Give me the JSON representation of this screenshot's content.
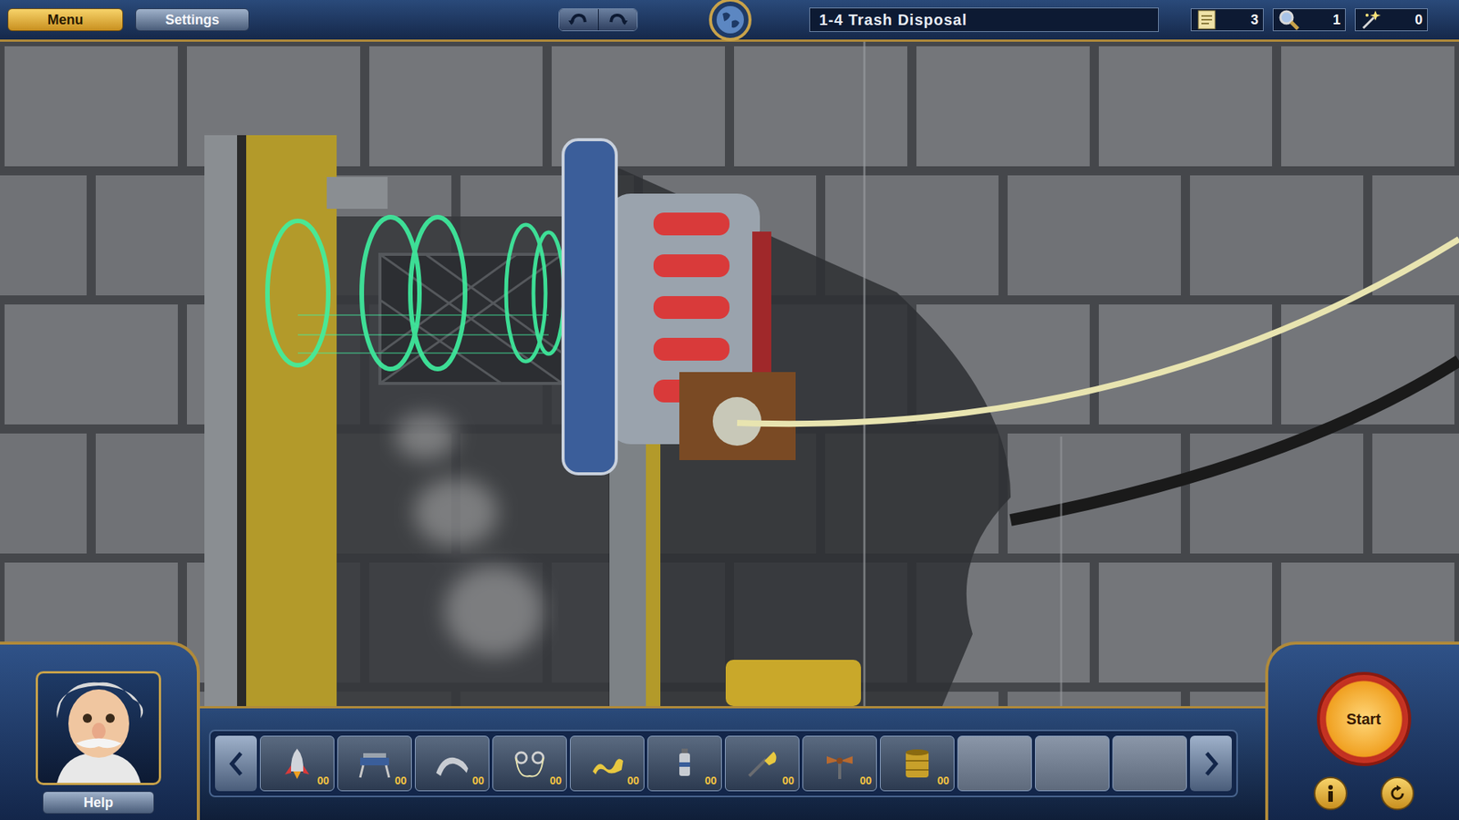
{
  "top_bar": {
    "menu_button": "Menu",
    "settings_button": "Settings",
    "level_title": "1-4 Trash Disposal",
    "counters": [
      {
        "value": "3"
      },
      {
        "value": "1"
      },
      {
        "value": "0"
      }
    ]
  },
  "help_panel": {
    "help_button": "Help"
  },
  "toolbar": {
    "slots": [
      {
        "kind": "item",
        "count": "00"
      },
      {
        "kind": "item",
        "count": "00"
      },
      {
        "kind": "item",
        "count": "00"
      },
      {
        "kind": "item",
        "count": "00"
      },
      {
        "kind": "item",
        "count": "00"
      },
      {
        "kind": "item",
        "count": "00"
      },
      {
        "kind": "item",
        "count": "00"
      },
      {
        "kind": "item",
        "count": "00"
      },
      {
        "kind": "item",
        "count": "00"
      },
      {
        "kind": "empty"
      },
      {
        "kind": "empty"
      },
      {
        "kind": "empty"
      }
    ]
  },
  "controls": {
    "start_button": "Start"
  }
}
